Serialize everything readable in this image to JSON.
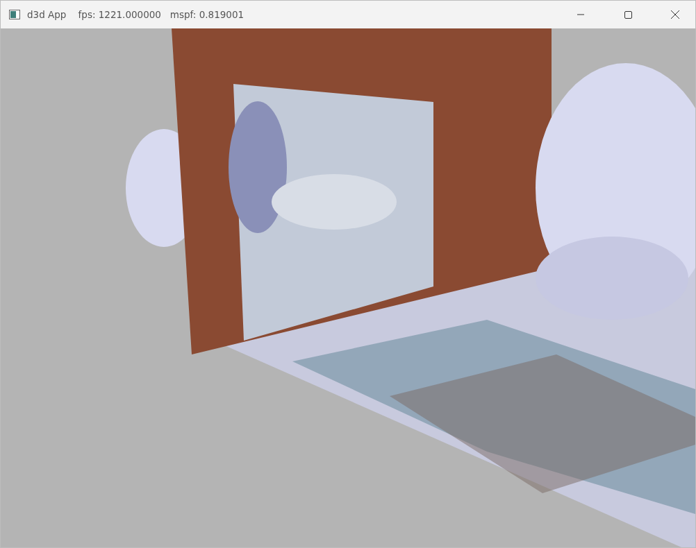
{
  "window": {
    "title": "d3d App    fps: 1221.000000   mspf: 0.819001"
  }
}
